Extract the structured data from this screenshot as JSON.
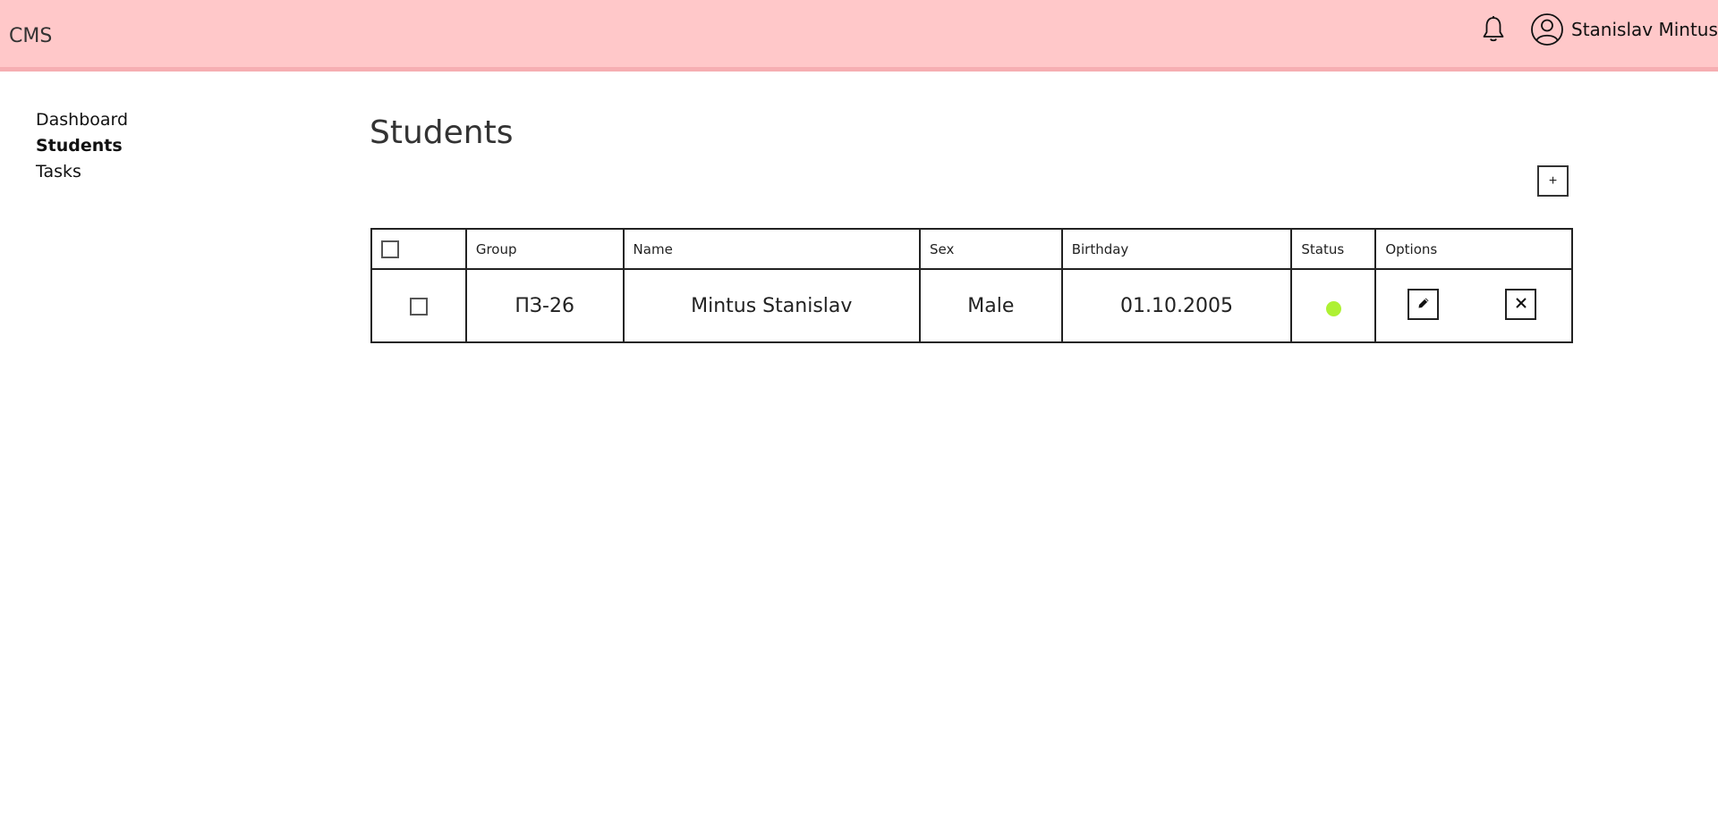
{
  "header": {
    "brand": "CMS",
    "user_name": "Stanislav Mintus",
    "icons": {
      "notifications": "bell-icon",
      "profile": "user-circle-icon"
    },
    "background_color": "#ffc8c9",
    "border_color": "#f6aeb2"
  },
  "sidebar": {
    "items": [
      {
        "label": "Dashboard",
        "active": false
      },
      {
        "label": "Students",
        "active": true
      },
      {
        "label": "Tasks",
        "active": false
      }
    ]
  },
  "main": {
    "title": "Students",
    "add_button_label": "+",
    "table": {
      "columns": [
        "",
        "Group",
        "Name",
        "Sex",
        "Birthday",
        "Status",
        "Options"
      ],
      "rows": [
        {
          "selected": false,
          "group": "ПЗ-26",
          "name": "Mintus Stanislav",
          "sex": "Male",
          "birthday": "01.10.2005",
          "status": "active",
          "status_color": "#aef133",
          "options": {
            "edit_icon": "pencil-icon",
            "delete_icon": "close-icon"
          }
        }
      ]
    }
  }
}
